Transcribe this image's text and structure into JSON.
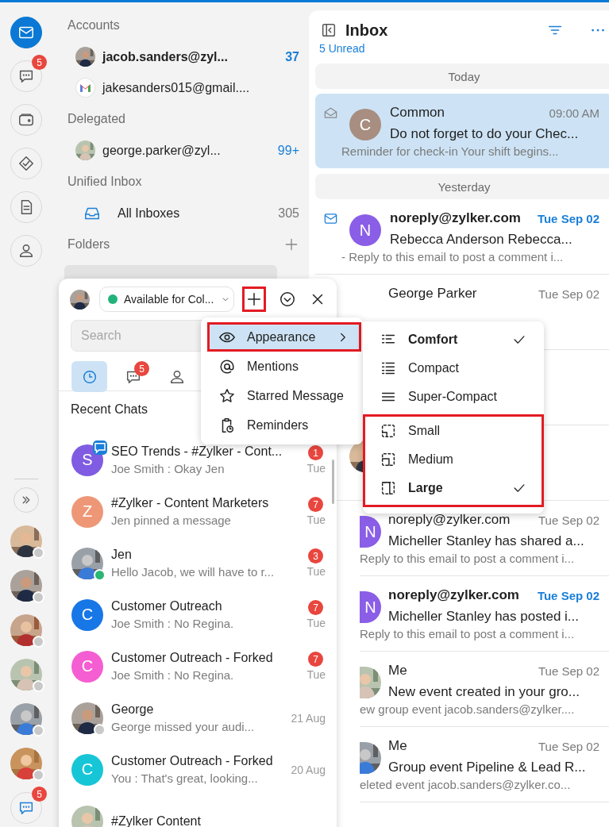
{
  "rail": {
    "items": [
      {
        "selected": true
      },
      {
        "selected": false,
        "badge": "5"
      },
      {
        "selected": false
      },
      {
        "selected": false
      },
      {
        "selected": false
      },
      {
        "selected": false
      }
    ],
    "contacts": [
      {
        "online": false
      },
      {
        "online": false
      },
      {
        "online": false
      },
      {
        "online": false
      },
      {
        "online": false
      },
      {
        "online": false
      }
    ],
    "chat_badge": "5"
  },
  "folders": {
    "sections": [
      {
        "title": "Accounts",
        "items": [
          {
            "label": "jacob.sanders@zyl...",
            "count": "37",
            "bold": true,
            "count_highlight": true
          },
          {
            "kind": "gmail",
            "label": "jakesanders015@gmail....",
            "bold": false
          }
        ]
      },
      {
        "title": "Delegated",
        "items": [
          {
            "label": "george.parker@zyl...",
            "count": "99+",
            "bold": false,
            "count_highlight": true
          }
        ]
      },
      {
        "title": "Unified Inbox",
        "items": [
          {
            "kind": "inbox",
            "label": "All Inboxes",
            "count": "305",
            "bold": false,
            "count_highlight": false
          }
        ]
      },
      {
        "title": "Folders",
        "addable": true,
        "selected_row": true
      }
    ]
  },
  "mail": {
    "title": "Inbox",
    "unread": "5 Unread",
    "rows": [
      {
        "kind": "divider",
        "label": "Today"
      },
      {
        "kind": "mail",
        "selected": true,
        "unread": false,
        "covered": false,
        "avatar": {
          "kind": "letter",
          "letter": "C",
          "color": "#a88e80"
        },
        "sender": "Common",
        "date": "09:00 AM",
        "subject": "Do not forget to do your Chec...",
        "preview": "Reminder for check-in Your shift begins..."
      },
      {
        "kind": "divider",
        "label": "Yesterday"
      },
      {
        "kind": "mail",
        "selected": false,
        "unread": true,
        "covered": false,
        "avatar": {
          "kind": "letter",
          "letter": "N",
          "color": "#8a5ee6"
        },
        "sender": "noreply@zylker.com",
        "date": "Tue Sep 02",
        "subject": "Rebecca Anderson Rebecca...",
        "preview": "- Reply to this email to post a comment i..."
      },
      {
        "kind": "mail",
        "selected": false,
        "unread": false,
        "covered": true,
        "sender": "George Parker",
        "date": "Tue Sep 02"
      },
      {
        "kind": "hidden"
      },
      {
        "kind": "hidden"
      },
      {
        "kind": "mail",
        "selected": false,
        "unread": false,
        "covered": true,
        "avatar": {
          "kind": "letter",
          "letter": "N",
          "color": "#8a5ee6"
        },
        "sender": "noreply@zylker.com",
        "date": "Tue Sep 02",
        "subject": "Micheller Stanley has shared a...",
        "preview": "Reply to this email to post a comment i..."
      },
      {
        "kind": "mail",
        "selected": false,
        "unread": true,
        "covered": true,
        "avatar": {
          "kind": "letter",
          "letter": "N",
          "color": "#8a5ee6"
        },
        "sender": "noreply@zylker.com",
        "date": "Tue Sep 02",
        "subject": "Micheller Stanley has posted i...",
        "preview": "Reply to this email to post a comment i..."
      },
      {
        "kind": "mail",
        "selected": false,
        "unread": false,
        "covered": true,
        "sender": "Me",
        "date": "Tue Sep 02",
        "subject": "New event created in your gro...",
        "preview": "ew group event jacob.sanders@zylker...."
      },
      {
        "kind": "mail",
        "selected": false,
        "unread": false,
        "covered": true,
        "sender": "Me",
        "date": "Tue Sep 02",
        "subject": "Group event Pipeline & Lead R...",
        "preview": "eleted event jacob.sanders@zylker.co..."
      }
    ]
  },
  "chat": {
    "status": "Available for Col...",
    "online": true,
    "add_highlighted": true,
    "search_placeholder": "Search",
    "tabs": [
      {
        "selected": true
      },
      {
        "selected": false,
        "badge": "5"
      },
      {
        "selected": false
      }
    ],
    "section": "Recent Chats",
    "chats": [
      {
        "name": "SEO Trends - #Zylker - Cont...",
        "preview": "Joe Smith : Okay Jen",
        "time": "Tue",
        "badge": "1",
        "channel": true,
        "avatar": {
          "kind": "letter",
          "letter": "S",
          "color": "#7f5ce2"
        }
      },
      {
        "name": "#Zylker - Content Marketers",
        "preview": "Jen pinned a message",
        "time": "Tue",
        "badge": "7",
        "avatar": {
          "kind": "letter",
          "letter": "Z",
          "color": "#ee9777"
        }
      },
      {
        "name": "Jen",
        "preview": "Hello Jacob, we will have to r...",
        "time": "Tue",
        "badge": "3",
        "online": true
      },
      {
        "name": "Customer Outreach",
        "preview": "Joe Smith : No Regina.",
        "time": "Tue",
        "badge": "7",
        "avatar": {
          "kind": "letter",
          "letter": "C",
          "color": "#1877e6"
        }
      },
      {
        "name": "Customer Outreach - Forked",
        "preview": "Joe Smith : No Regina.",
        "time": "Tue",
        "badge": "7",
        "avatar": {
          "kind": "letter",
          "letter": "C",
          "color": "#f45ed2"
        }
      },
      {
        "name": "George",
        "preview": "George missed your audi...",
        "time": "21 Aug",
        "online": false
      },
      {
        "name": "Customer Outreach - Forked",
        "preview": "You : That's great, looking...",
        "time": "20 Aug",
        "avatar": {
          "kind": "letter",
          "letter": "C",
          "color": "#16c6d6"
        }
      },
      {
        "name": "#Zylker Content"
      }
    ]
  },
  "menu": {
    "items": [
      {
        "label": "Appearance",
        "selected": true,
        "highlighted": true,
        "submenu": true
      },
      {
        "label": "Mentions",
        "selected": false,
        "highlighted": false,
        "submenu": false
      },
      {
        "label": "Starred Message",
        "selected": false,
        "highlighted": false,
        "submenu": false
      },
      {
        "label": "Reminders",
        "selected": false,
        "highlighted": false,
        "submenu": false
      }
    ]
  },
  "submenu": {
    "groups": [
      {
        "items": [
          {
            "label": "Comfort",
            "checked": true
          },
          {
            "label": "Compact",
            "checked": false
          },
          {
            "label": "Super-Compact",
            "checked": false
          }
        ]
      },
      {
        "highlighted": true,
        "items": [
          {
            "label": "Small",
            "checked": false
          },
          {
            "label": "Medium",
            "checked": false
          },
          {
            "label": "Large",
            "checked": true
          }
        ]
      }
    ]
  }
}
